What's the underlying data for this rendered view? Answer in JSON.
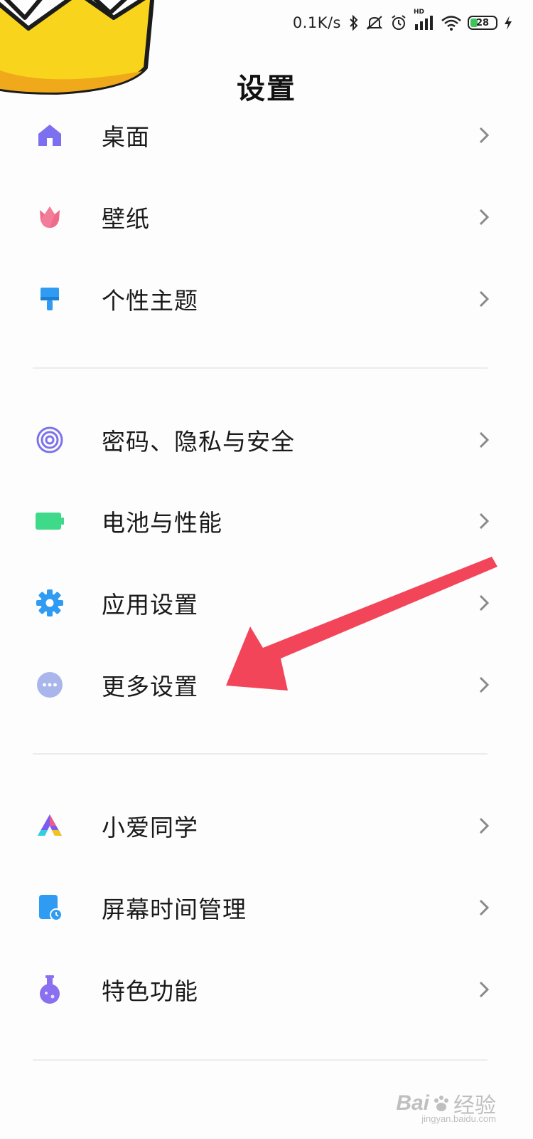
{
  "status_bar": {
    "net_speed": "0.1K/s",
    "hd_label": "HD",
    "battery_level": "28",
    "icons": [
      "bluetooth-icon",
      "mute-icon",
      "alarm-icon",
      "signal-icon",
      "wifi-icon",
      "battery-icon",
      "charging-icon"
    ]
  },
  "header": {
    "title": "设置"
  },
  "groups": [
    {
      "items": [
        {
          "label": "桌面",
          "icon": "home-icon",
          "color": "#7c6ff0"
        },
        {
          "label": "壁纸",
          "icon": "tulip-icon",
          "color": "#f06a8a"
        },
        {
          "label": "个性主题",
          "icon": "brush-icon",
          "color": "#2f9bf2"
        }
      ]
    },
    {
      "items": [
        {
          "label": "密码、隐私与安全",
          "icon": "fingerprint-icon",
          "color": "#7b73ea"
        },
        {
          "label": "电池与性能",
          "icon": "battery-icon",
          "color": "#3fd98a"
        },
        {
          "label": "应用设置",
          "icon": "gear-icon",
          "color": "#2f9bf2"
        },
        {
          "label": "更多设置",
          "icon": "more-icon",
          "color": "#a9b6ec"
        }
      ]
    },
    {
      "items": [
        {
          "label": "小爱同学",
          "icon": "xiaoai-icon",
          "color": "#7b5cf0"
        },
        {
          "label": "屏幕时间管理",
          "icon": "screen-time-icon",
          "color": "#2f9bf2"
        },
        {
          "label": "特色功能",
          "icon": "flask-icon",
          "color": "#8a6ff0"
        }
      ]
    }
  ],
  "annotation": {
    "arrow_color": "#f2455a",
    "points_to": "更多设置"
  },
  "watermark": {
    "brand": "Bai",
    "brand_tail": "经验",
    "url": "jingyan.baidu.com"
  }
}
